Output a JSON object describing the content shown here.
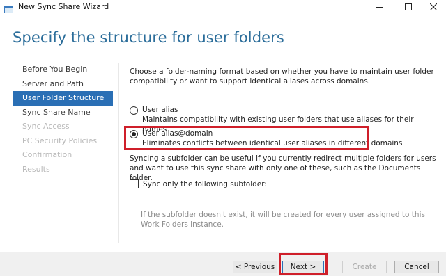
{
  "window": {
    "title": "New Sync Share Wizard",
    "controls": {
      "minimize": "minimize-icon",
      "maximize": "maximize-icon",
      "close": "close-icon"
    }
  },
  "page_heading": "Specify the structure for user folders",
  "nav": {
    "items": [
      {
        "label": "Before You Begin",
        "state": "normal"
      },
      {
        "label": "Server and Path",
        "state": "normal"
      },
      {
        "label": "User Folder Structure",
        "state": "active"
      },
      {
        "label": "Sync Share Name",
        "state": "normal"
      },
      {
        "label": "Sync Access",
        "state": "disabled"
      },
      {
        "label": "PC Security Policies",
        "state": "disabled"
      },
      {
        "label": "Confirmation",
        "state": "disabled"
      },
      {
        "label": "Results",
        "state": "disabled"
      }
    ]
  },
  "content": {
    "intro": "Choose a folder-naming format based on whether you have to maintain user folder compatibility or want to support identical aliases across domains.",
    "options": [
      {
        "label": "User alias",
        "description": "Maintains compatibility with existing user folders that use aliases for their names",
        "selected": false
      },
      {
        "label": "User alias@domain",
        "description": "Eliminates conflicts between identical user aliases in different domains",
        "selected": true
      }
    ],
    "sync_description": "Syncing a subfolder can be useful if you currently redirect multiple folders for users and want to use this sync share with only one of these, such as the Documents folder.",
    "subfolder_checkbox": {
      "label": "Sync only the following subfolder:",
      "checked": false
    },
    "subfolder_input": {
      "value": "",
      "placeholder": ""
    },
    "hint": "If the subfolder doesn't exist, it will be created for every user assigned to this Work Folders instance."
  },
  "footer": {
    "previous": "< Previous",
    "next": "Next >",
    "create": "Create",
    "cancel": "Cancel"
  },
  "colors": {
    "heading": "#2b6d9a",
    "nav_active_bg": "#2a6fb5",
    "highlight": "#cf1f2a"
  }
}
